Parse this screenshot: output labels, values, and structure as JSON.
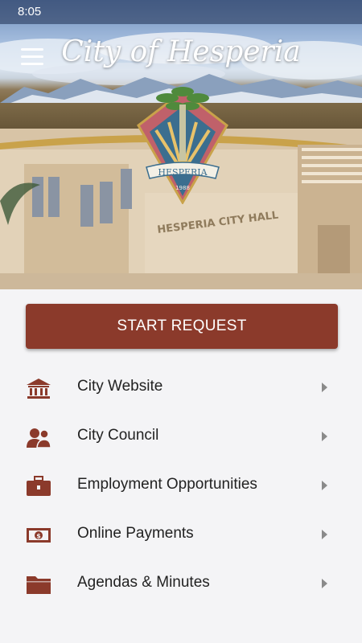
{
  "status_bar": {
    "time": "8:05"
  },
  "header": {
    "title": "City of Hesperia",
    "seal_text": "HESPERIA",
    "seal_year": "1988",
    "building_sign": "HESPERIA CITY HALL"
  },
  "start_button": {
    "label": "START REQUEST"
  },
  "menu": {
    "items": [
      {
        "label": "City Website",
        "icon": "city-hall-icon"
      },
      {
        "label": "City Council",
        "icon": "people-icon"
      },
      {
        "label": "Employment Opportunities",
        "icon": "briefcase-icon"
      },
      {
        "label": "Online Payments",
        "icon": "money-icon"
      },
      {
        "label": "Agendas & Minutes",
        "icon": "folder-icon"
      }
    ]
  },
  "colors": {
    "accent": "#8b3a2b",
    "icon": "#8b3a2b",
    "chevron": "#8a8a8a",
    "background": "#f4f4f6"
  }
}
